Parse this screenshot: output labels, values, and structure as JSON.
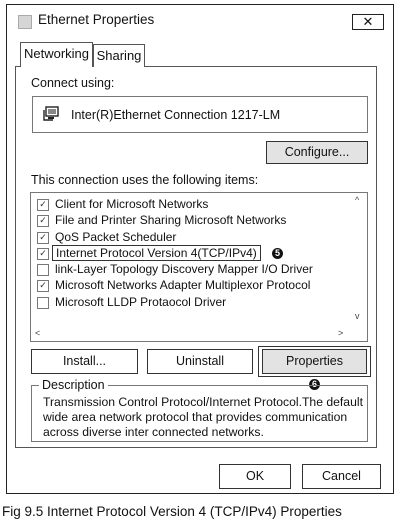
{
  "window": {
    "title": "Ethernet Properties",
    "close_label": "✕"
  },
  "tabs": [
    {
      "label": "Networking"
    },
    {
      "label": "Sharing"
    }
  ],
  "connect_using": {
    "label": "Connect using:",
    "adapter_name": "Inter(R)Ethernet Connection 1217-LM",
    "adapter_icon": "network-adapter-icon"
  },
  "configure_label": "Configure...",
  "items_label": "This connection uses the following items:",
  "items": [
    {
      "label": "Client for Microsoft Networks",
      "checked": true
    },
    {
      "label": "File and Printer Sharing Microsoft Networks",
      "checked": true
    },
    {
      "label": "QoS Packet Scheduler",
      "checked": true
    },
    {
      "label": "Internet Protocol Version 4(TCP/IPv4)",
      "checked": true,
      "badge": "5"
    },
    {
      "label": "link-Layer Topology Discovery Mapper I/O Driver",
      "checked": false
    },
    {
      "label": "Microsoft Networks Adapter Multiplexor Protocol",
      "checked": true
    },
    {
      "label": "Microsoft LLDP Protaocol Driver",
      "checked": false
    }
  ],
  "scroll_arrows": {
    "up": "^",
    "down": "v",
    "left": "<",
    "right": ">"
  },
  "buttons": {
    "install": "Install...",
    "uninstall": "Uninstall",
    "properties": "Properties",
    "properties_badge": "6"
  },
  "description": {
    "legend": "Description",
    "text": "Transmission Control Protocol/Internet Protocol.The default wide area network protocol that provides communication across diverse inter connected networks."
  },
  "footer": {
    "ok": "OK",
    "cancel": "Cancel"
  },
  "caption": "Fig 9.5 Internet Protocol Version 4 (TCP/IPv4) Properties",
  "colors": {
    "button_face": "#e3e3e3",
    "border": "#333333",
    "background": "#ffffff"
  }
}
